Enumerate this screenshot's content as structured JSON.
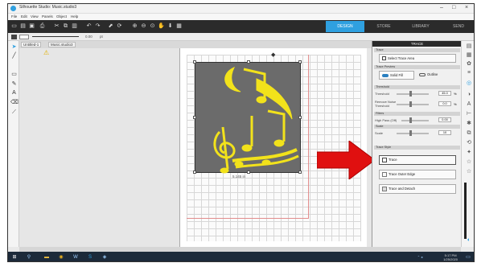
{
  "window": {
    "title": "Silhouette Studio: Music.studio3",
    "controls": [
      "–",
      "□",
      "×"
    ]
  },
  "menu": [
    "File",
    "Edit",
    "View",
    "Panels",
    "Object",
    "Help"
  ],
  "toolbar_tabs": [
    {
      "label": "DESIGN",
      "active": true
    },
    {
      "label": "STORE",
      "active": false
    },
    {
      "label": "LIBRARY",
      "active": false
    },
    {
      "label": "SEND",
      "active": false
    }
  ],
  "property_bar": {
    "line_value": "0.00",
    "unit": "pt"
  },
  "doc_tabs": [
    "Untitled-1",
    "Music.studio3"
  ],
  "canvas": {
    "dimension_label": "5.145 in",
    "warning_icon": "warning-icon",
    "brand": "silhouette"
  },
  "trace_panel": {
    "header": "TRACE",
    "select_section": "Trace",
    "select_button": "Select Trace Area",
    "preview_section": "Trace Preview",
    "preview_options": [
      "Solid Fill",
      "Outline"
    ],
    "threshold_section": "Threshold",
    "threshold_label": "Threshold",
    "threshold_value": "45.0",
    "threshold_unit": "%",
    "remove_label": "Remove Noise",
    "remove_label2": "Threshold",
    "remove_value": "0.0",
    "remove_unit": "%",
    "filter_section": "Filters",
    "highpass_label": "High Pass (Off)",
    "highpass_value": "0.00",
    "scale_section": "Scale",
    "scale_label": "Scale",
    "scale_value": "10",
    "style_section": "Trace Style",
    "trace_button": "Trace",
    "trace_outer_button": "Trace Outer Edge",
    "trace_detach_button": "Trace and Detach"
  },
  "accent": {
    "arrow": "#e01010",
    "music": "#f2e21b",
    "design_tab": "#2fa0e0"
  },
  "clock": {
    "time": "5:17 PM",
    "date": "1/25/2020"
  }
}
